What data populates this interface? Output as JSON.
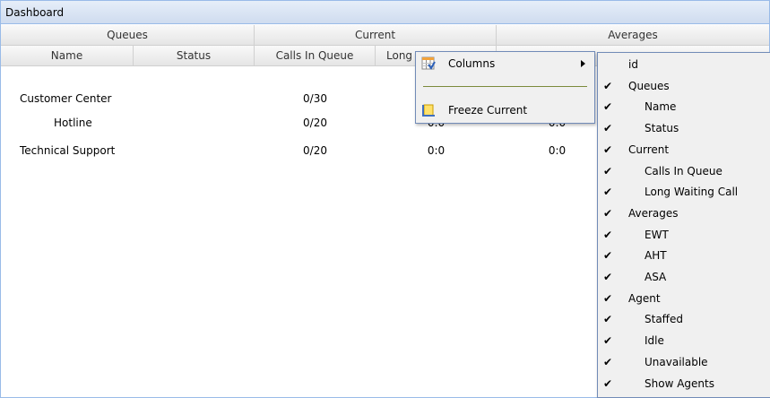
{
  "panel": {
    "title": "Dashboard"
  },
  "grid": {
    "group_headers": [
      "Queues",
      "Current",
      "Averages"
    ],
    "columns": [
      "Name",
      "Status",
      "Calls In Queue",
      "Long"
    ],
    "rows": [
      {
        "name": "Customer Center",
        "status": "",
        "calls": "0/30",
        "long": "",
        "avg": ""
      },
      {
        "name": "Hotline",
        "status": "",
        "calls": "0/20",
        "long": "0:0",
        "avg": "0:0"
      },
      {
        "name": "Technical Support",
        "status": "",
        "calls": "0/20",
        "long": "0:0",
        "avg": "0:0"
      }
    ]
  },
  "header_menu": {
    "items": [
      {
        "label": "Columns",
        "icon": "columns-icon",
        "has_submenu": true
      },
      {
        "label": "Freeze Current",
        "icon": "freeze-icon"
      }
    ]
  },
  "columns_menu": {
    "items": [
      {
        "label": "id",
        "checked": false,
        "level": 0
      },
      {
        "label": "Queues",
        "checked": true,
        "level": 0
      },
      {
        "label": "Name",
        "checked": true,
        "level": 1
      },
      {
        "label": "Status",
        "checked": true,
        "level": 1
      },
      {
        "label": "Current",
        "checked": true,
        "level": 0
      },
      {
        "label": "Calls In Queue",
        "checked": true,
        "level": 1
      },
      {
        "label": "Long Waiting Call",
        "checked": true,
        "level": 1
      },
      {
        "label": "Averages",
        "checked": true,
        "level": 0
      },
      {
        "label": "EWT",
        "checked": true,
        "level": 1
      },
      {
        "label": "AHT",
        "checked": true,
        "level": 1
      },
      {
        "label": "ASA",
        "checked": true,
        "level": 1
      },
      {
        "label": "Agent",
        "checked": true,
        "level": 0
      },
      {
        "label": "Staffed",
        "checked": true,
        "level": 1
      },
      {
        "label": "Idle",
        "checked": true,
        "level": 1
      },
      {
        "label": "Unavailable",
        "checked": true,
        "level": 1
      },
      {
        "label": "Show Agents",
        "checked": true,
        "level": 1
      }
    ]
  }
}
